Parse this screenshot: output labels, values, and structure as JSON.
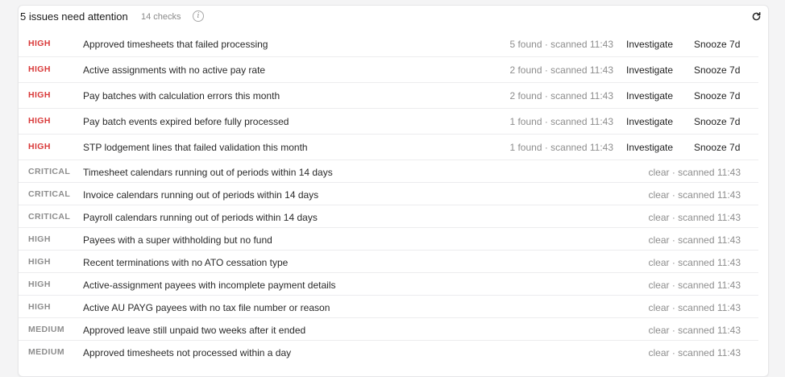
{
  "header": {
    "title": "5 issues need attention",
    "checks": "14 checks",
    "info_icon": "info-icon",
    "refresh_icon": "refresh-icon"
  },
  "colors": {
    "high_active": "#d93a3a",
    "muted": "#8d8d8d"
  },
  "rows": [
    {
      "severity": "HIGH",
      "description": "Approved timesheets that failed processing",
      "status": "5 found · scanned 11:43",
      "state": "found",
      "investigate": "Investigate",
      "snooze": "Snooze 7d"
    },
    {
      "severity": "HIGH",
      "description": "Active assignments with no active pay rate",
      "status": "2 found · scanned 11:43",
      "state": "found",
      "investigate": "Investigate",
      "snooze": "Snooze 7d"
    },
    {
      "severity": "HIGH",
      "description": "Pay batches with calculation errors this month",
      "status": "2 found · scanned 11:43",
      "state": "found",
      "investigate": "Investigate",
      "snooze": "Snooze 7d"
    },
    {
      "severity": "HIGH",
      "description": "Pay batch events expired before fully processed",
      "status": "1 found · scanned 11:43",
      "state": "found",
      "investigate": "Investigate",
      "snooze": "Snooze 7d"
    },
    {
      "severity": "HIGH",
      "description": "STP lodgement lines that failed validation this month",
      "status": "1 found · scanned 11:43",
      "state": "found",
      "investigate": "Investigate",
      "snooze": "Snooze 7d"
    },
    {
      "severity": "CRITICAL",
      "description": "Timesheet calendars running out of periods within 14 days",
      "status": "clear · scanned 11:43",
      "state": "clear"
    },
    {
      "severity": "CRITICAL",
      "description": "Invoice calendars running out of periods within 14 days",
      "status": "clear · scanned 11:43",
      "state": "clear"
    },
    {
      "severity": "CRITICAL",
      "description": "Payroll calendars running out of periods within 14 days",
      "status": "clear · scanned 11:43",
      "state": "clear"
    },
    {
      "severity": "HIGH",
      "description": "Payees with a super withholding but no fund",
      "status": "clear · scanned 11:43",
      "state": "clear"
    },
    {
      "severity": "HIGH",
      "description": "Recent terminations with no ATO cessation type",
      "status": "clear · scanned 11:43",
      "state": "clear"
    },
    {
      "severity": "HIGH",
      "description": "Active-assignment payees with incomplete payment details",
      "status": "clear · scanned 11:43",
      "state": "clear"
    },
    {
      "severity": "HIGH",
      "description": "Active AU PAYG payees with no tax file number or reason",
      "status": "clear · scanned 11:43",
      "state": "clear"
    },
    {
      "severity": "MEDIUM",
      "description": "Approved leave still unpaid two weeks after it ended",
      "status": "clear · scanned 11:43",
      "state": "clear"
    },
    {
      "severity": "MEDIUM",
      "description": "Approved timesheets not processed within a day",
      "status": "clear · scanned 11:43",
      "state": "clear"
    }
  ]
}
